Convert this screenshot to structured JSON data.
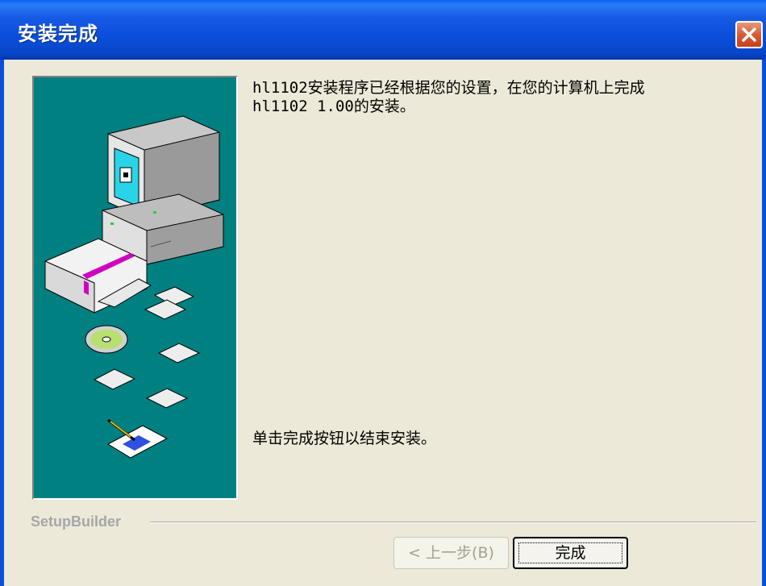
{
  "window": {
    "title": "安装完成"
  },
  "content": {
    "message_line1": "hl1102安装程序已经根据您的设置，在您的计算机上完成",
    "message_line2": "hl1102 1.00的安装。",
    "instruction": "单击完成按钮以结束安装。"
  },
  "footer": {
    "brand": "SetupBuilder",
    "back_label": "< 上一步(B)",
    "finish_label": "完成"
  },
  "icons": [
    "close-icon",
    "computer-illustration"
  ]
}
